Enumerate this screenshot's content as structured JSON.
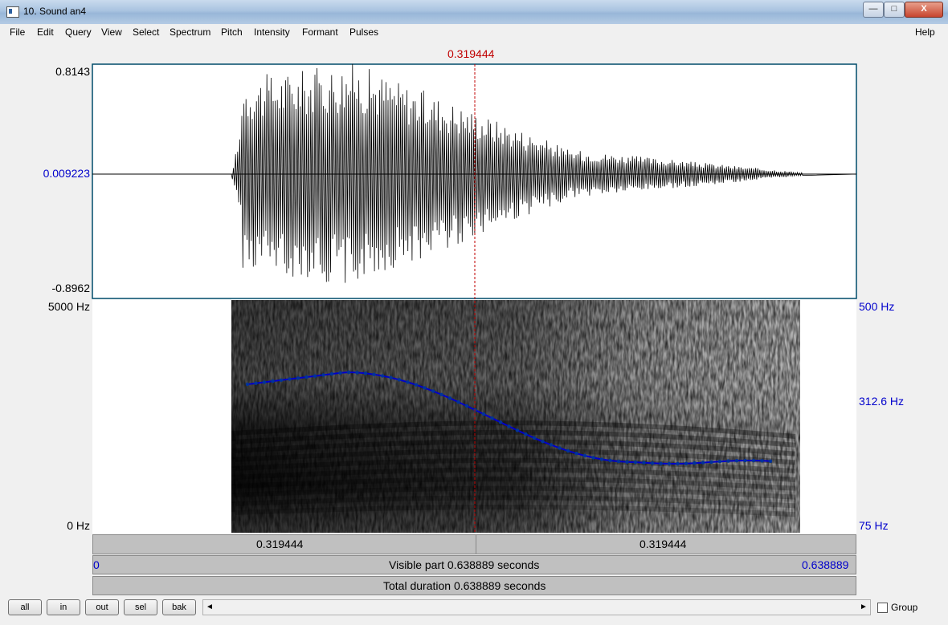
{
  "window": {
    "title": "10. Sound an4",
    "controls": {
      "minimize": "—",
      "maximize": "□",
      "close": "X"
    }
  },
  "menu": {
    "left": [
      "File",
      "Edit",
      "Query",
      "View",
      "Select",
      "Spectrum",
      "Pitch",
      "Intensity",
      "Formant",
      "Pulses"
    ],
    "right": "Help"
  },
  "cursor": {
    "time_label": "0.319444"
  },
  "waveform": {
    "y_max": "0.8143",
    "y_zero": "0.009223",
    "y_min": "-0.8962"
  },
  "spectrogram": {
    "freq_top": "5000 Hz",
    "freq_bottom": "0 Hz",
    "pitch_top": "500 Hz",
    "pitch_mid": "312.6 Hz",
    "pitch_bottom": "75 Hz"
  },
  "time_bars": {
    "left_segment": "0.319444",
    "right_segment": "0.319444",
    "visible_start": "0",
    "visible_label": "Visible part 0.638889 seconds",
    "visible_end": "0.638889",
    "total_label": "Total duration 0.638889 seconds"
  },
  "buttons": {
    "all": "all",
    "in": "in",
    "out": "out",
    "sel": "sel",
    "bak": "bak"
  },
  "scroll": {
    "left_arrow": "◄",
    "right_arrow": "►"
  },
  "group_label": "Group",
  "colors": {
    "cursor": "#c00000",
    "pitch": "#0000cc",
    "axis_blue": "#0000cc"
  }
}
